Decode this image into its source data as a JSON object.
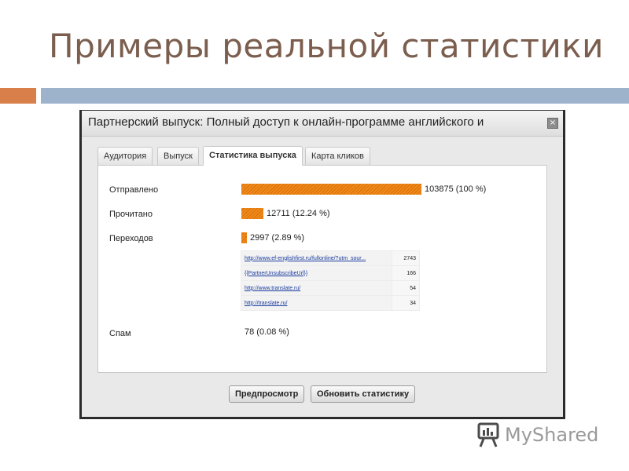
{
  "slide": {
    "title": "Примеры реальной статистики"
  },
  "dialog": {
    "title": "Партнерский выпуск: Полный доступ к онлайн-программе английского и",
    "close_symbol": "×"
  },
  "tabs": [
    {
      "label": "Аудитория",
      "active": false
    },
    {
      "label": "Выпуск",
      "active": false
    },
    {
      "label": "Статистика выпуска",
      "active": true
    },
    {
      "label": "Карта кликов",
      "active": false
    }
  ],
  "stats": {
    "sent": {
      "label": "Отправлено",
      "value": 103875,
      "percent": 100,
      "text": "103875 (100 %)"
    },
    "read": {
      "label": "Прочитано",
      "value": 12711,
      "percent": 12.24,
      "text": "12711 (12.24 %)"
    },
    "clicks": {
      "label": "Переходов",
      "value": 2997,
      "percent": 2.89,
      "text": "2997 (2.89 %)"
    },
    "spam": {
      "label": "Спам",
      "value": 78,
      "percent": 0.08,
      "text": "78 (0.08 %)"
    }
  },
  "links": [
    {
      "url": "http://www.ef-englishfirst.ru/fullonline/?utm_sour...",
      "count": "2743"
    },
    {
      "url": "{{PartnerUnsubscribeUrl}}",
      "count": "166"
    },
    {
      "url": "http://www.translate.ru/",
      "count": "54"
    },
    {
      "url": "http://translate.ru/",
      "count": "34"
    }
  ],
  "buttons": {
    "preview": "Предпросмотр",
    "refresh": "Обновить статистику"
  },
  "watermark": {
    "text": "MyShared"
  },
  "colors": {
    "bar": "#f08a1c",
    "title": "#7b5e4e",
    "accent_orange": "#d9804a",
    "accent_blue": "#9db3cc"
  }
}
